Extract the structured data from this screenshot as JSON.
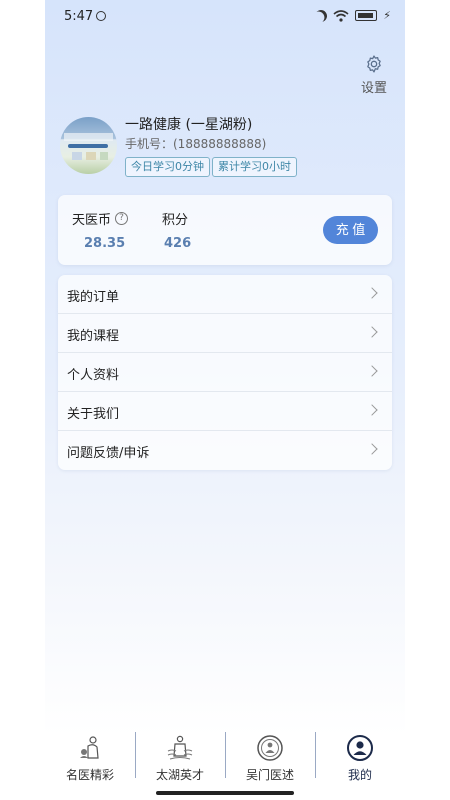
{
  "status_bar": {
    "time": "5:47"
  },
  "settings": {
    "label": "设置",
    "icon": "gear-icon"
  },
  "profile": {
    "name": "一路健康 (一星湖粉)",
    "phone": "手机号：(18888888888)",
    "tag_today": "今日学习0分钟",
    "tag_total": "累计学习0小时"
  },
  "wallet": {
    "coin_label": "天医币",
    "coin_help_icon": "question-circle-icon",
    "coin_value": "28.35",
    "points_label": "积分",
    "points_value": "426",
    "recharge_label": "充 值",
    "accent": "#5285d9",
    "value_color": "#5a7fb0"
  },
  "menu": {
    "items": [
      {
        "label": "我的订单"
      },
      {
        "label": "我的课程"
      },
      {
        "label": "个人资料"
      },
      {
        "label": "关于我们"
      },
      {
        "label": "问题反馈/申诉"
      }
    ]
  },
  "bottom_nav": {
    "items": [
      {
        "label": "名医精彩",
        "icon": "doctor-figure-icon"
      },
      {
        "label": "太湖英才",
        "icon": "scholar-figure-icon"
      },
      {
        "label": "吴门医述",
        "icon": "seal-medallion-icon"
      },
      {
        "label": "我的",
        "icon": "user-circle-icon",
        "active": true
      }
    ]
  }
}
